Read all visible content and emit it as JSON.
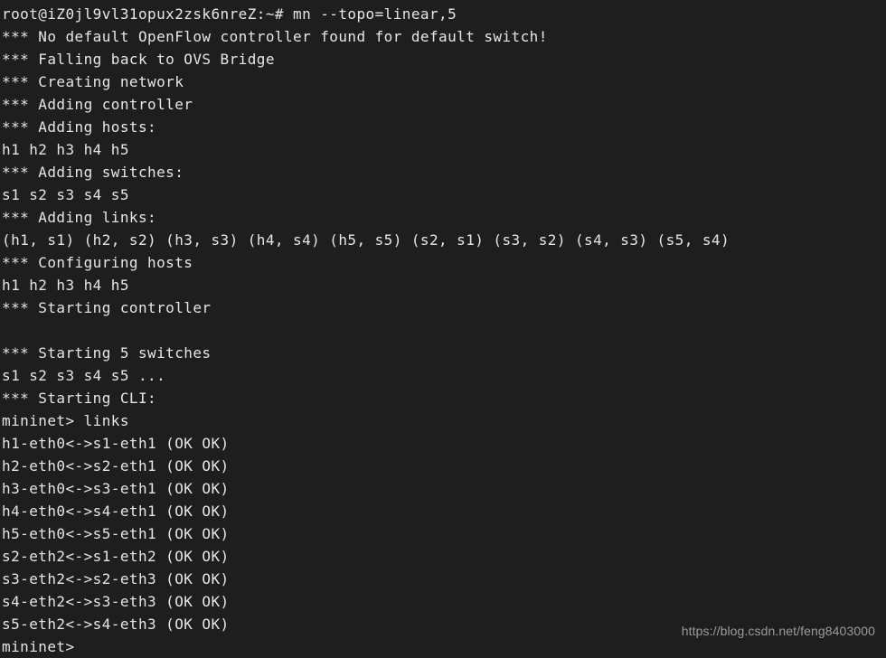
{
  "terminal": {
    "background_color": "#1e1e1e",
    "foreground_color": "#e6e6e6",
    "watermark": "https://blog.csdn.net/feng8403000",
    "prompt_user_host": "root@iZ0jl9vl31opux2zsk6nreZ",
    "prompt_path": "~",
    "prompt_symbol": "#",
    "mininet_prompt": "mininet>",
    "command_entered": "mn --topo=linear,5",
    "cli_command": "links",
    "lines": [
      "root@iZ0jl9vl31opux2zsk6nreZ:~# mn --topo=linear,5",
      "*** No default OpenFlow controller found for default switch!",
      "*** Falling back to OVS Bridge",
      "*** Creating network",
      "*** Adding controller",
      "*** Adding hosts:",
      "h1 h2 h3 h4 h5",
      "*** Adding switches:",
      "s1 s2 s3 s4 s5",
      "*** Adding links:",
      "(h1, s1) (h2, s2) (h3, s3) (h4, s4) (h5, s5) (s2, s1) (s3, s2) (s4, s3) (s5, s4)",
      "*** Configuring hosts",
      "h1 h2 h3 h4 h5",
      "*** Starting controller",
      "",
      "*** Starting 5 switches",
      "s1 s2 s3 s4 s5 ...",
      "*** Starting CLI:",
      "mininet> links",
      "h1-eth0<->s1-eth1 (OK OK)",
      "h2-eth0<->s2-eth1 (OK OK)",
      "h3-eth0<->s3-eth1 (OK OK)",
      "h4-eth0<->s4-eth1 (OK OK)",
      "h5-eth0<->s5-eth1 (OK OK)",
      "s2-eth2<->s1-eth2 (OK OK)",
      "s3-eth2<->s2-eth3 (OK OK)",
      "s4-eth2<->s3-eth3 (OK OK)",
      "s5-eth2<->s4-eth3 (OK OK)",
      "mininet>"
    ]
  }
}
